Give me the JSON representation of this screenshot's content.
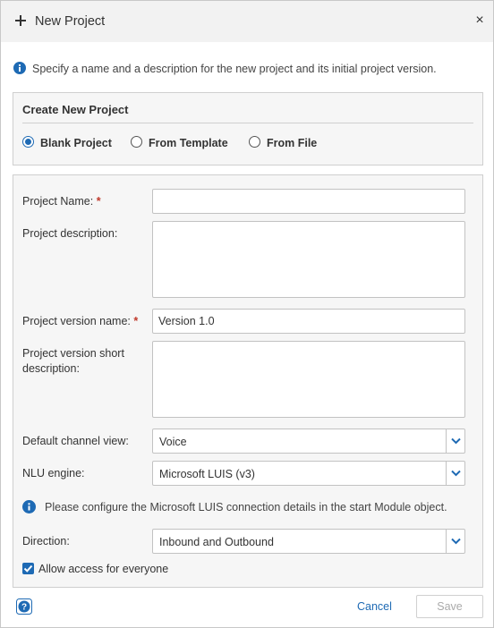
{
  "dialog": {
    "title": "New Project",
    "close_glyph": "×",
    "info_text": "Specify a name and a description for the new project and its initial project version."
  },
  "panel": {
    "title": "Create New Project",
    "options": [
      {
        "label": "Blank Project",
        "selected": true
      },
      {
        "label": "From Template",
        "selected": false
      },
      {
        "label": "From File",
        "selected": false
      }
    ]
  },
  "form": {
    "project_name_label": "Project Name:",
    "project_name_value": "",
    "project_description_label": "Project description:",
    "version_name_label": "Project version name:",
    "version_name_value": "Version 1.0",
    "version_short_desc_label_1": "Project version short",
    "version_short_desc_label_2": "description:",
    "required_marker": "*",
    "channel_label": "Default channel view:",
    "channel_value": "Voice",
    "nlu_label": "NLU engine:",
    "nlu_value": "Microsoft LUIS (v3)",
    "nlu_note": "Please configure the Microsoft LUIS connection details in the start Module object.",
    "direction_label": "Direction:",
    "direction_value": "Inbound and Outbound",
    "allow_access_label": "Allow access for everyone",
    "allow_access_checked": true
  },
  "footer": {
    "help_glyph": "?",
    "cancel_label": "Cancel",
    "save_label": "Save"
  },
  "colors": {
    "accent": "#1e6ab4",
    "header_bg": "#f2f2f2",
    "required": "#c0392b"
  }
}
